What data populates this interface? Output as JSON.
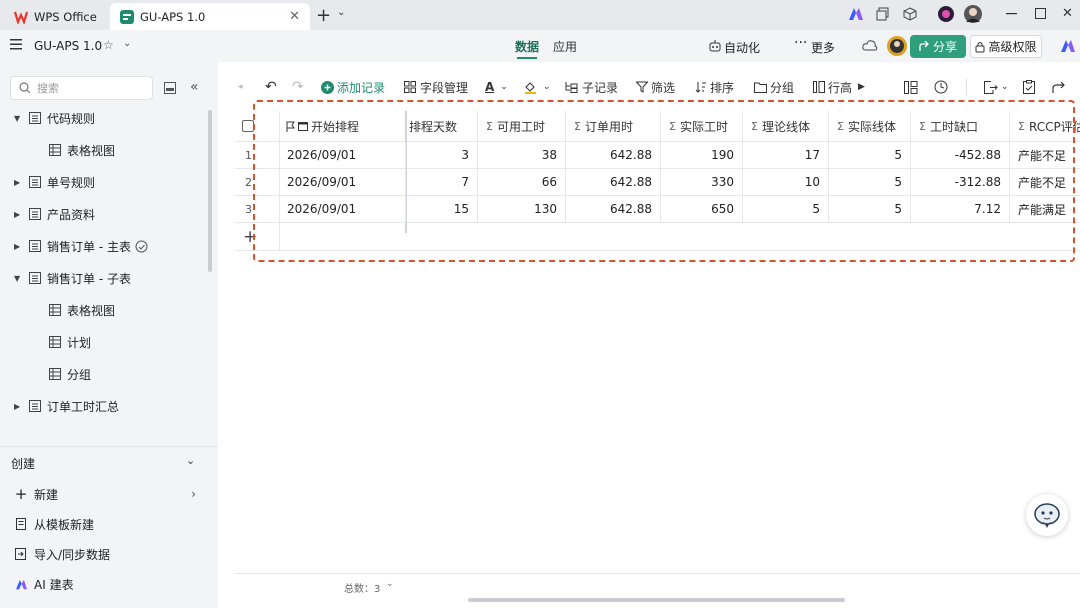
{
  "window": {
    "tabs": [
      {
        "label": "WPS Office",
        "icon": "wps-logo-icon"
      },
      {
        "label": "GU-APS 1.0",
        "icon": "app-logo-icon"
      }
    ]
  },
  "appbar": {
    "doc_title": "GU-APS 1.0",
    "center_tabs": [
      "数据",
      "应用"
    ],
    "automation": "自动化",
    "more": "更多",
    "share": "分享",
    "permission": "高级权限"
  },
  "sidebar": {
    "search_placeholder": "搜索",
    "items": [
      {
        "label": "代码规则",
        "level": 0,
        "expanded": true
      },
      {
        "label": "表格视图",
        "level": 1
      },
      {
        "label": "单号规则",
        "level": 0,
        "expanded": false
      },
      {
        "label": "产品资料",
        "level": 0,
        "expanded": false
      },
      {
        "label": "销售订单 - 主表",
        "level": 0,
        "expanded": false,
        "badge": "sync-icon"
      },
      {
        "label": "销售订单 - 子表",
        "level": 0,
        "expanded": true
      },
      {
        "label": "表格视图",
        "level": 1
      },
      {
        "label": "计划",
        "level": 1
      },
      {
        "label": "分组",
        "level": 1
      },
      {
        "label": "订单工时汇总",
        "level": 0,
        "expanded": false
      }
    ],
    "create_section": "创建",
    "create_items": [
      {
        "label": "新建",
        "icon": "plus-icon"
      },
      {
        "label": "从模板新建",
        "icon": "template-icon"
      },
      {
        "label": "导入/同步数据",
        "icon": "import-icon"
      },
      {
        "label": "AI 建表",
        "icon": "ai-icon"
      }
    ]
  },
  "toolbar": {
    "add_record": "添加记录",
    "field_manage": "字段管理",
    "sub_record": "子记录",
    "filter": "筛选",
    "sort": "排序",
    "group": "分组",
    "row_height": "行高"
  },
  "table": {
    "columns": [
      "开始排程",
      "排程天数",
      "可用工时",
      "订单用时",
      "实际工时",
      "理论线体",
      "实际线体",
      "工时缺口",
      "RCCP评估"
    ],
    "rows": [
      {
        "no": "1",
        "cells": [
          "2026/09/01",
          "3",
          "38",
          "642.88",
          "190",
          "17",
          "5",
          "-452.88",
          "产能不足"
        ]
      },
      {
        "no": "2",
        "cells": [
          "2026/09/01",
          "7",
          "66",
          "642.88",
          "330",
          "10",
          "5",
          "-312.88",
          "产能不足"
        ]
      },
      {
        "no": "3",
        "cells": [
          "2026/09/01",
          "15",
          "130",
          "642.88",
          "650",
          "5",
          "5",
          "7.12",
          "产能满足"
        ]
      }
    ],
    "footer_total": "总数：3"
  },
  "colors": {
    "accent": "#1f8a70",
    "highlight_border": "#d9532a",
    "share_bg": "#2f9e7a"
  }
}
